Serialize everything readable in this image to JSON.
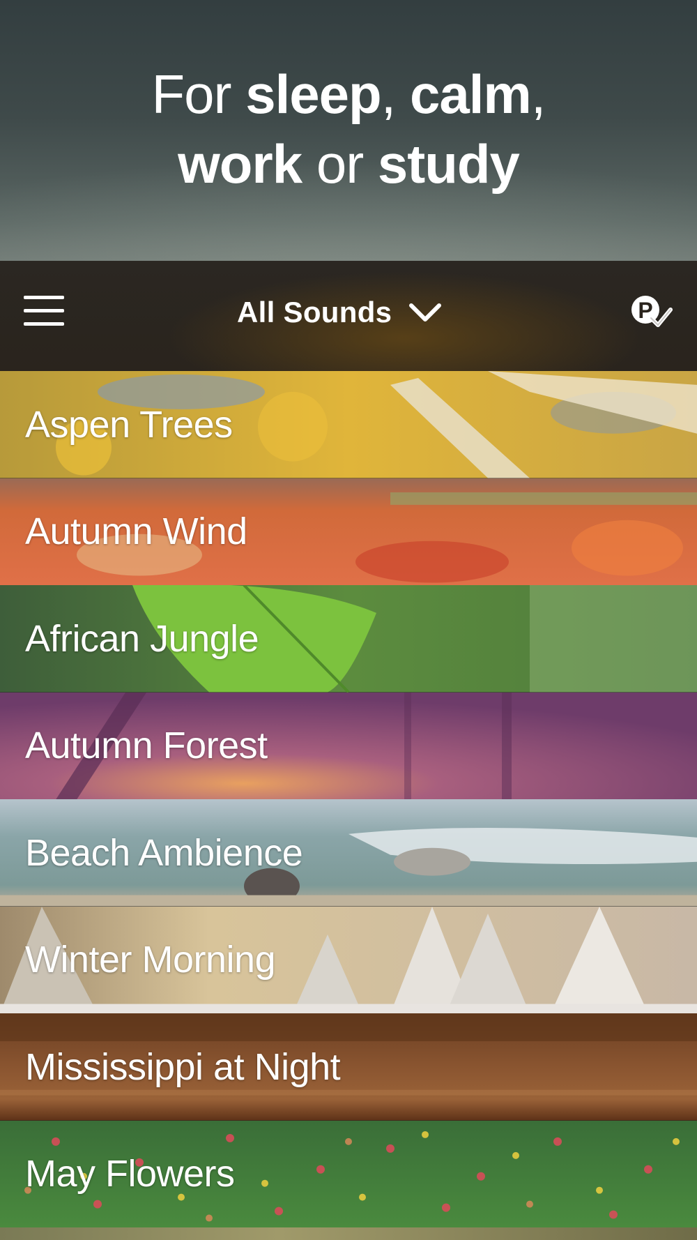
{
  "hero": {
    "line1_prefix": "For ",
    "line1_word1": "sleep",
    "line1_sep": ", ",
    "line1_word2": "calm",
    "line1_suffix": ",",
    "line2_word1": "work",
    "line2_sep": " or ",
    "line2_word2": "study"
  },
  "navbar": {
    "menu_icon": "hamburger-menu-icon",
    "title": "All Sounds",
    "dropdown_icon": "chevron-down-icon",
    "premium_icon": "premium-check-icon"
  },
  "sounds": [
    {
      "label": "Aspen Trees"
    },
    {
      "label": "Autumn Wind"
    },
    {
      "label": "African Jungle"
    },
    {
      "label": "Autumn Forest"
    },
    {
      "label": "Beach Ambience"
    },
    {
      "label": "Winter Morning"
    },
    {
      "label": "Mississippi at Night"
    },
    {
      "label": "May Flowers"
    }
  ],
  "colors": {
    "hero_top": "#333e40",
    "navbar": "#2a241d",
    "text": "#ffffff"
  }
}
